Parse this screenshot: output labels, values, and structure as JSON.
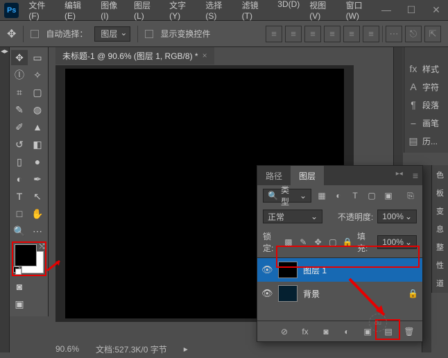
{
  "app": {
    "logo": "Ps"
  },
  "menu": {
    "file": "文件(F)",
    "edit": "编辑(E)",
    "image": "图像(I)",
    "layer": "图层(L)",
    "text": "文字(Y)",
    "select": "选择(S)",
    "filter": "滤镜(T)",
    "d3": "3D(D)",
    "view": "视图(V)",
    "window": "窗口(W)"
  },
  "opt": {
    "auto_select": "自动选择：",
    "layer": "图层",
    "show_ctrl": "显示变换控件"
  },
  "doc": {
    "tab": "未标题-1 @ 90.6% (图层 1, RGB/8) *"
  },
  "right": {
    "styles": "样式",
    "char": "字符",
    "para": "段落",
    "brush": "画笔",
    "history": "历...",
    "color": "色",
    "swatch": "板",
    "adjust": "变",
    "info": "息",
    "adjust2": "整",
    "props": "性",
    "path": "道"
  },
  "layers": {
    "tab_path": "路径",
    "tab_layer": "图层",
    "kind": "类型",
    "blend": "正常",
    "opacity_label": "不透明度:",
    "opacity_val": "100%",
    "lock_label": "锁定:",
    "fill_label": "填充:",
    "fill_val": "100%",
    "l1": "图层  1",
    "bg": "背景"
  },
  "status": {
    "zoom": "90.6%",
    "docinfo": "文档:527.3K/0 字节"
  },
  "icons": {},
  "chart_data": null
}
